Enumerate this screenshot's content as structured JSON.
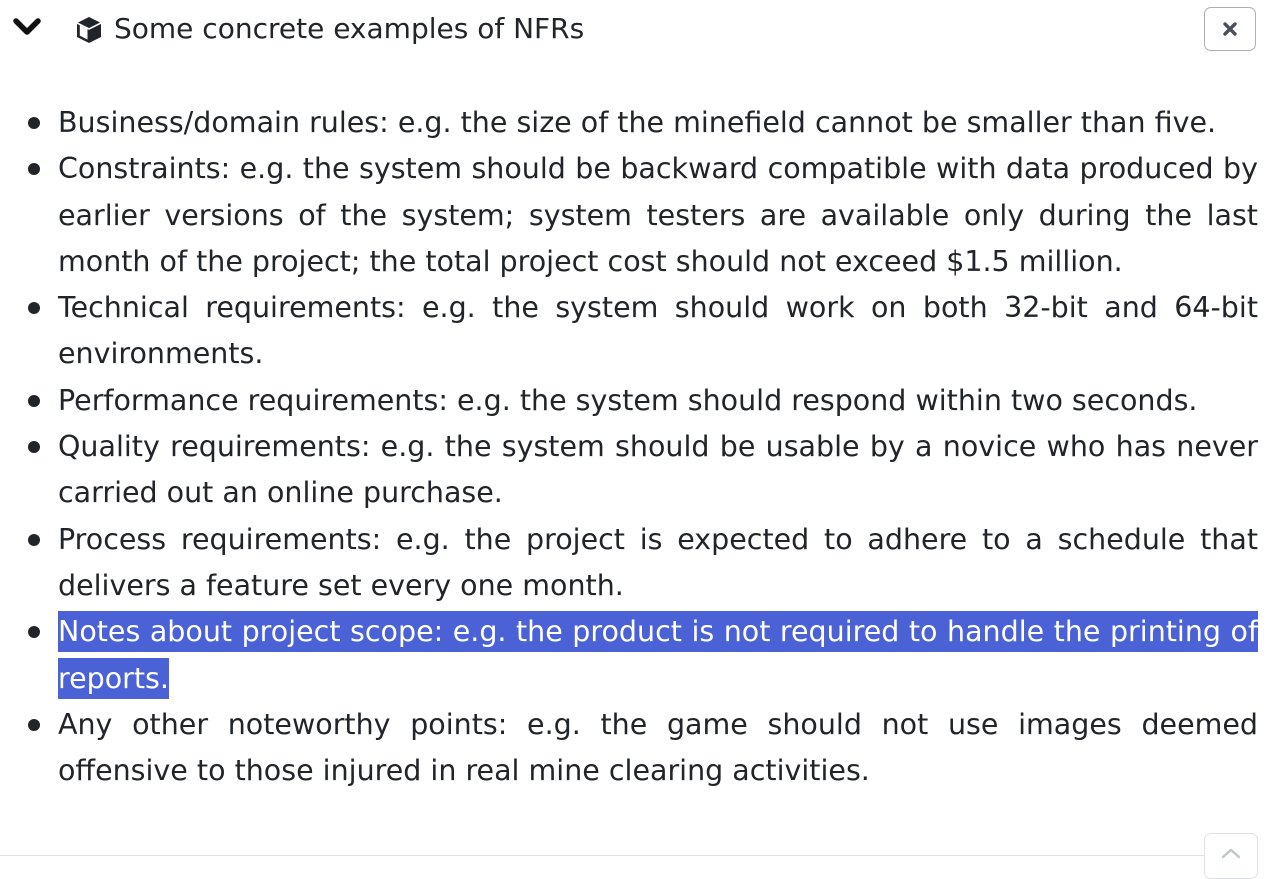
{
  "panel": {
    "title": "Some concrete examples of NFRs",
    "icons": {
      "toggle": "chevron-down-icon",
      "title": "box-icon",
      "close": "close-icon",
      "scroll": "chevron-up-icon"
    },
    "colors": {
      "selection": "#4a62d6",
      "text": "#212529"
    }
  },
  "items": [
    "Business/domain rules: e.g. the size of the minefield cannot be smaller than five.",
    "Constraints: e.g. the system should be backward compatible with data produced by earlier versions of the system; system testers are available only during the last month of the project; the total project cost should not exceed $1.5 million.",
    "Technical requirements: e.g. the system should work on both 32-bit and 64-bit environments.",
    "Performance requirements: e.g. the system should respond within two seconds.",
    "Quality requirements: e.g. the system should be usable by a novice who has never carried out an online purchase.",
    "Process requirements: e.g. the project is expected to adhere to a schedule that delivers a feature set every one month.",
    "Notes about project scope: e.g. the product is not required to handle the printing of reports.",
    "Any other noteworthy points: e.g. the game should not use images deemed offensive to those injured in real mine clearing activities."
  ]
}
